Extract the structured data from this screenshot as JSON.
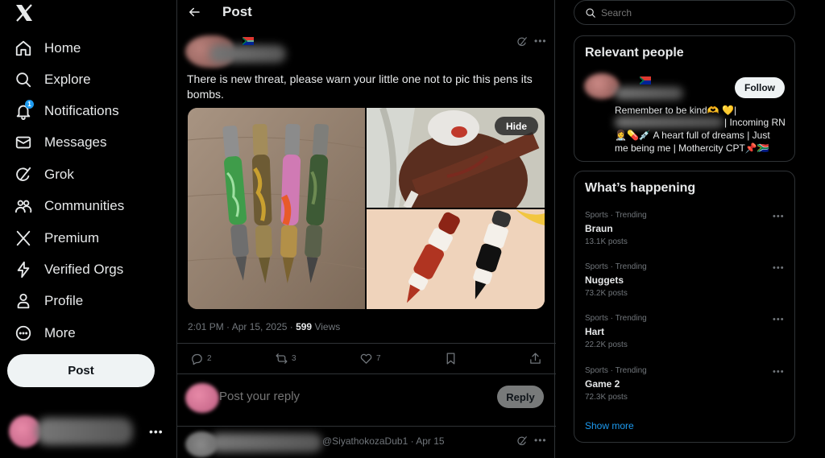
{
  "nav": {
    "items": [
      {
        "label": "Home",
        "icon": "home-icon"
      },
      {
        "label": "Explore",
        "icon": "search-icon"
      },
      {
        "label": "Notifications",
        "icon": "bell-icon",
        "badge": "1"
      },
      {
        "label": "Messages",
        "icon": "envelope-icon"
      },
      {
        "label": "Grok",
        "icon": "grok-icon"
      },
      {
        "label": "Communities",
        "icon": "people-icon"
      },
      {
        "label": "Premium",
        "icon": "x-logo-icon"
      },
      {
        "label": "Verified Orgs",
        "icon": "lightning-icon"
      },
      {
        "label": "Profile",
        "icon": "person-icon"
      },
      {
        "label": "More",
        "icon": "more-circle-icon"
      }
    ],
    "post_label": "Post"
  },
  "header": {
    "title": "Post"
  },
  "tweet": {
    "text": "There is new threat, please warn your little one not to pic this pens its bombs.",
    "hide_label": "Hide",
    "time": "2:01 PM · Apr 15, 2025 · ",
    "views_count": "599",
    "views_label": " Views",
    "replies": "2",
    "retweets": "3",
    "likes": "7"
  },
  "reply": {
    "placeholder": "Post your reply",
    "button": "Reply"
  },
  "reply2": {
    "handle": "@SiyathokozaDub1 · Apr 15"
  },
  "search": {
    "placeholder": "Search"
  },
  "relevant": {
    "title": "Relevant people",
    "follow_label": "Follow",
    "bio_line1": "Remember to be kind🫶 💛|",
    "bio_line2": "| Incoming RN",
    "bio_line3": "👩‍⚕️💊💉 A heart full of dreams | Just",
    "bio_line4": "me being me | Mothercity CPT📌🇿🇦"
  },
  "happening": {
    "title": "What’s happening",
    "trends": [
      {
        "category": "Sports · Trending",
        "name": "Braun",
        "count": "13.1K posts"
      },
      {
        "category": "Sports · Trending",
        "name": "Nuggets",
        "count": "73.2K posts"
      },
      {
        "category": "Sports · Trending",
        "name": "Hart",
        "count": "22.2K posts"
      },
      {
        "category": "Sports · Trending",
        "name": "Game 2",
        "count": "72.3K posts"
      }
    ],
    "show_more": "Show more"
  },
  "colors": {
    "accent": "#1d9bf0",
    "text": "#e7e9ea",
    "muted": "#71767b",
    "border": "#2f3336"
  }
}
